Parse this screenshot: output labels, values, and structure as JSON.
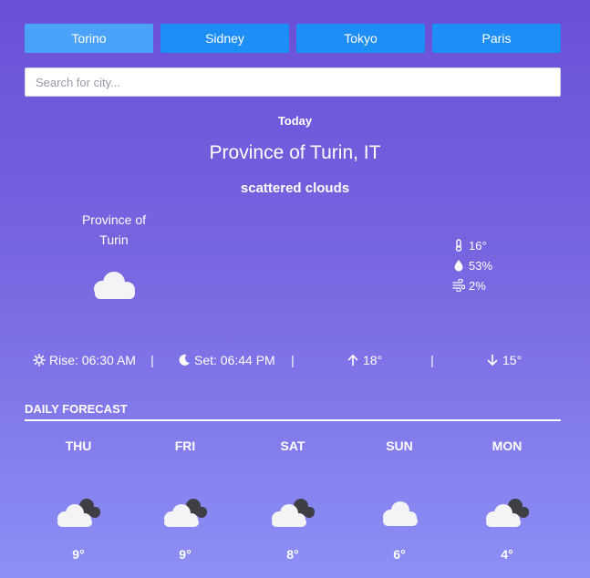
{
  "cities": [
    "Torino",
    "Sidney",
    "Tokyo",
    "Paris"
  ],
  "search": {
    "placeholder": "Search for city..."
  },
  "current": {
    "label": "Today",
    "location": "Province of Turin, IT",
    "description": "scattered clouds",
    "location_short": "Province of Turin",
    "icon": "cloud-icon",
    "temperature": "16°",
    "humidity": "53%",
    "wind": "2%",
    "sunrise": "Rise: 06:30 AM",
    "sunset": "Set: 06:44 PM",
    "high": "18°",
    "low": "15°",
    "separator": "|"
  },
  "daily": {
    "title": "DAILY FORECAST",
    "days": [
      {
        "name": "THU",
        "temp": "9°",
        "icon": "cloud-dark-icon"
      },
      {
        "name": "FRI",
        "temp": "9°",
        "icon": "cloud-dark-icon"
      },
      {
        "name": "SAT",
        "temp": "8°",
        "icon": "cloud-dark-icon"
      },
      {
        "name": "SUN",
        "temp": "6°",
        "icon": "cloud-icon"
      },
      {
        "name": "MON",
        "temp": "4°",
        "icon": "cloud-dark-icon"
      }
    ]
  },
  "colors": {
    "tab": "#1e8ef7",
    "tab_active": "#4aa3f8",
    "bg_top": "#6a4fd6",
    "bg_bottom": "#8d8ff5"
  }
}
